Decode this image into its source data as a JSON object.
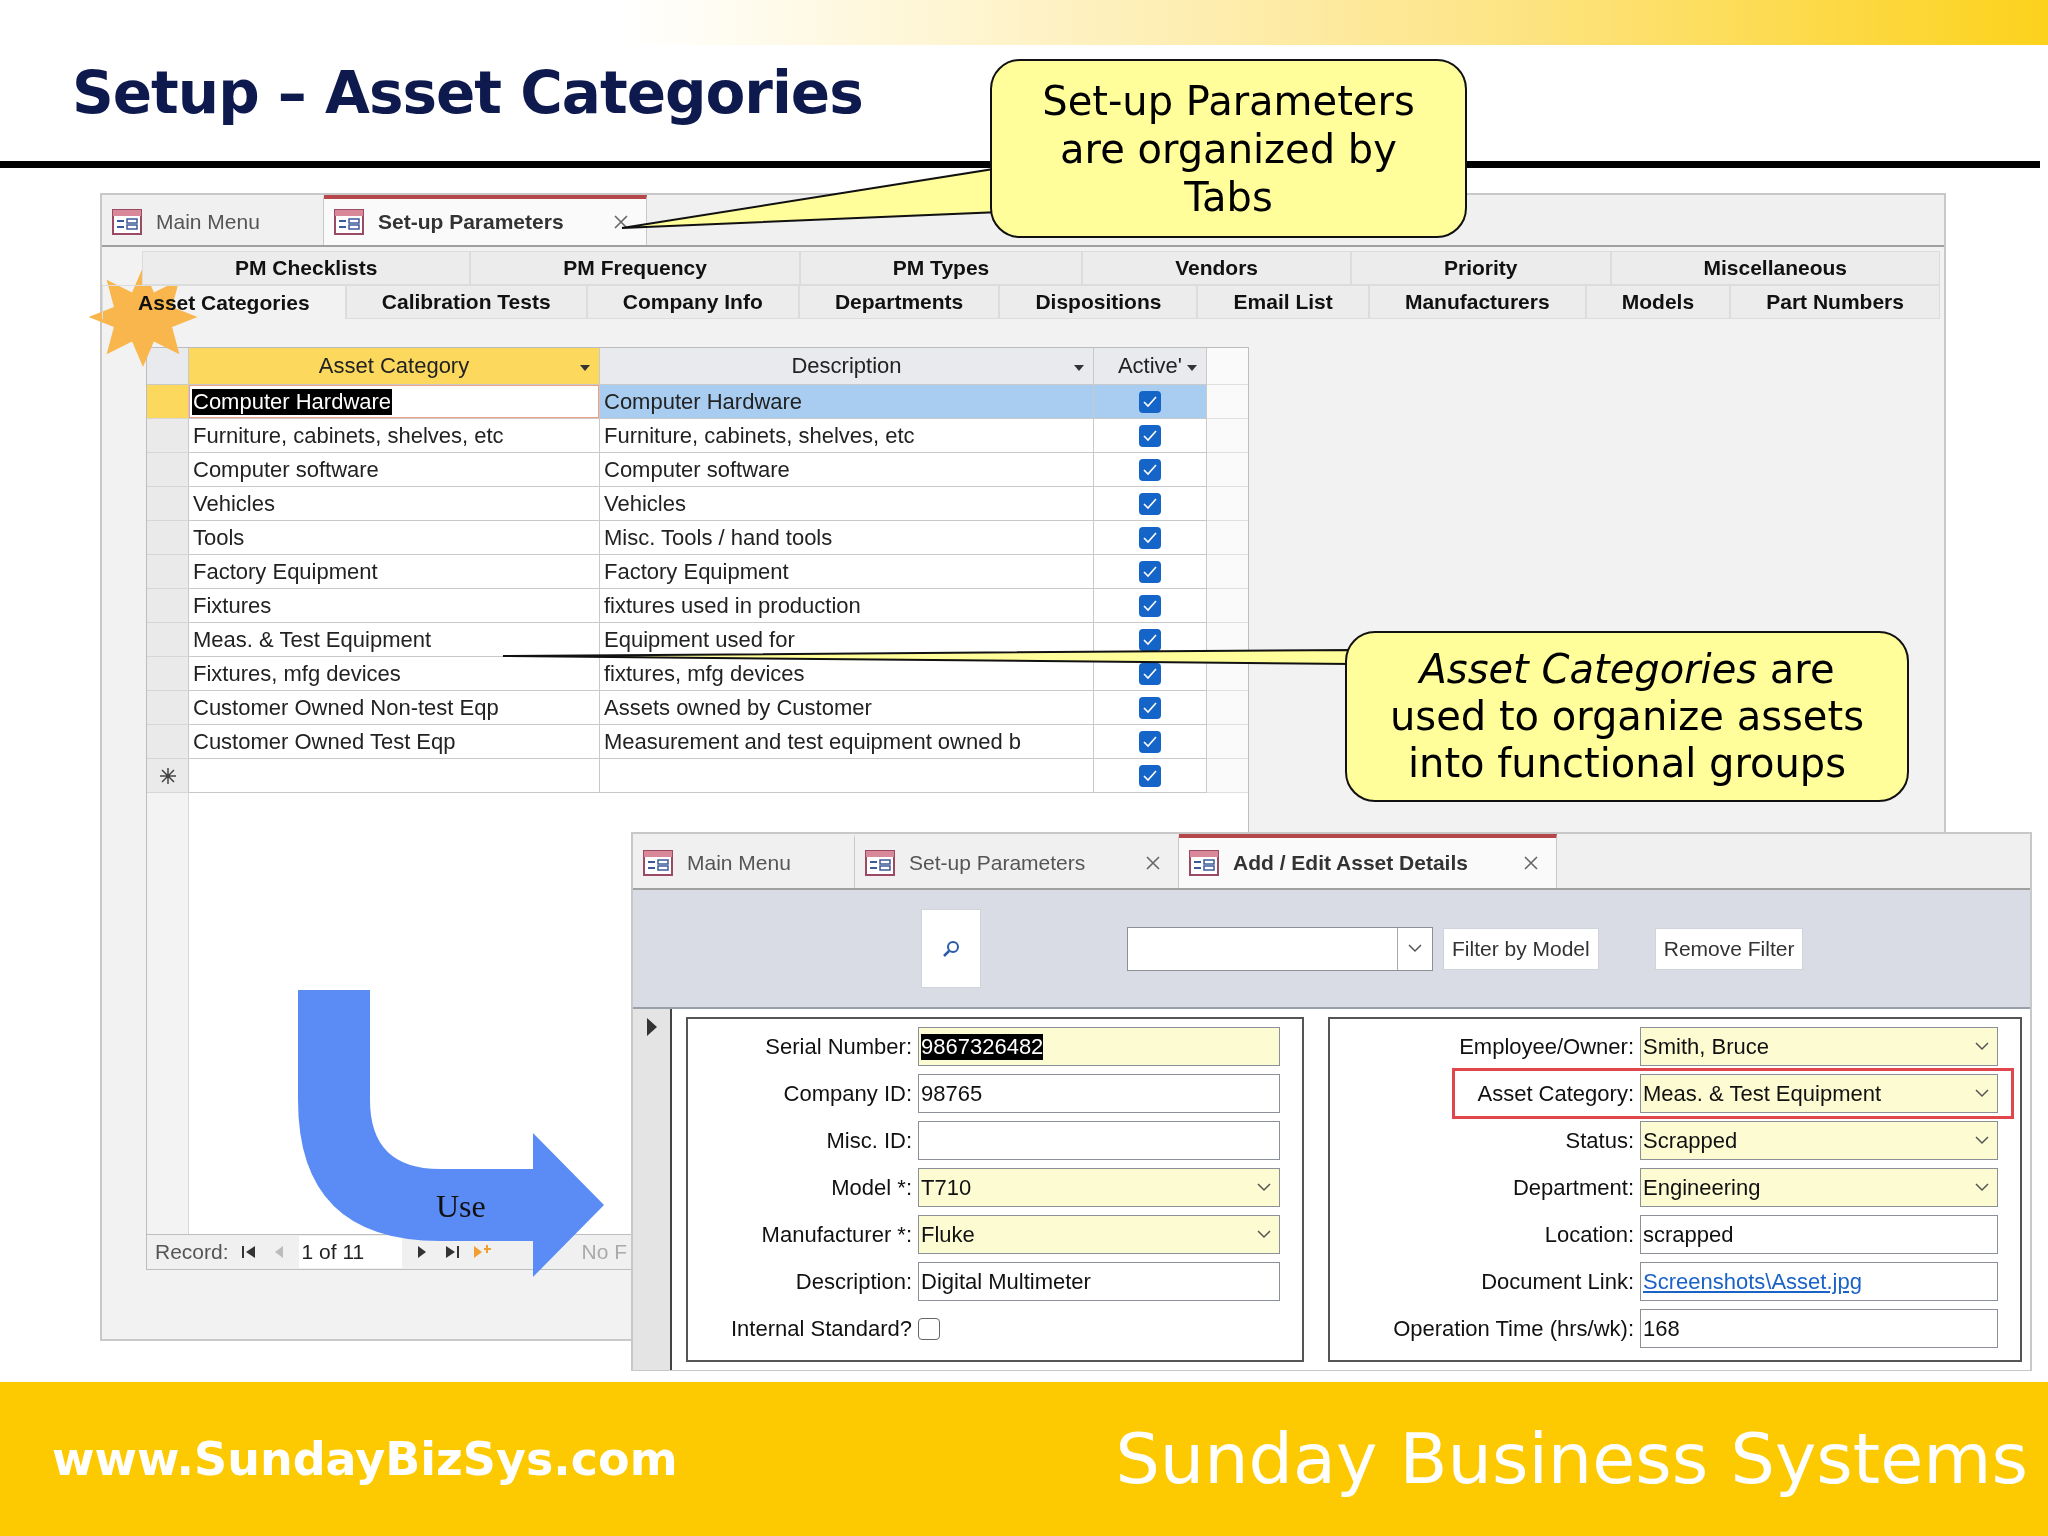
{
  "slide": {
    "title": "Setup – Asset Categories",
    "callouts": [
      {
        "text": "Set-up Parameters are organized by Tabs"
      },
      {
        "text": "*Asset Categories* are used to organize assets into functional groups"
      }
    ],
    "arrow_label": "Use",
    "footer": {
      "url": "www.SundayBizSys.com",
      "brand": "Sunday Business Systems"
    }
  },
  "setup_window": {
    "tabs": [
      {
        "label": "Main Menu",
        "selected": false,
        "closable": false
      },
      {
        "label": "Set-up Parameters",
        "selected": true,
        "closable": true
      }
    ],
    "subtabs": {
      "row_1": [
        {
          "label": "PM Checklists",
          "selected": false
        },
        {
          "label": "PM Frequency",
          "selected": false
        },
        {
          "label": "PM Types",
          "selected": false
        },
        {
          "label": "Vendors",
          "selected": false
        },
        {
          "label": "Priority",
          "selected": false
        },
        {
          "label": "Miscellaneous",
          "selected": false
        }
      ],
      "row_2": [
        {
          "label": "Asset Categories",
          "selected": true
        },
        {
          "label": "Calibration Tests",
          "selected": false
        },
        {
          "label": "Company Info",
          "selected": false
        },
        {
          "label": "Departments",
          "selected": false
        },
        {
          "label": "Dispositions",
          "selected": false
        },
        {
          "label": "Email List",
          "selected": false
        },
        {
          "label": "Manufacturers",
          "selected": false
        },
        {
          "label": "Models",
          "selected": false
        },
        {
          "label": "Part Numbers",
          "selected": false
        }
      ]
    },
    "datasheet": {
      "columns": [
        {
          "label": "Asset Category",
          "sorted": true
        },
        {
          "label": "Description",
          "sorted": false
        },
        {
          "label": "Active'",
          "sorted": false
        }
      ],
      "rows": [
        {
          "category": "Computer Hardware",
          "description": "Computer Hardware",
          "active": true,
          "selected": true
        },
        {
          "category": "Furniture, cabinets, shelves, etc",
          "description": "Furniture, cabinets, shelves, etc",
          "active": true,
          "selected": false
        },
        {
          "category": "Computer software",
          "description": "Computer software",
          "active": true,
          "selected": false
        },
        {
          "category": "Vehicles",
          "description": "Vehicles",
          "active": true,
          "selected": false
        },
        {
          "category": "Tools",
          "description": "Misc. Tools / hand tools",
          "active": true,
          "selected": false
        },
        {
          "category": "Factory Equipment",
          "description": "Factory Equipment",
          "active": true,
          "selected": false
        },
        {
          "category": "Fixtures",
          "description": "fixtures used in production",
          "active": true,
          "selected": false
        },
        {
          "category": "Meas. & Test Equipment",
          "description": "Equipment used for",
          "active": true,
          "selected": false
        },
        {
          "category": "Fixtures, mfg devices",
          "description": "fixtures, mfg devices",
          "active": true,
          "selected": false
        },
        {
          "category": "Customer Owned Non-test Eqp",
          "description": "Assets owned by Customer",
          "active": true,
          "selected": false
        },
        {
          "category": "Customer Owned Test Eqp",
          "description": "Measurement and test equipment owned b",
          "active": true,
          "selected": false
        }
      ],
      "new_row": {
        "active": true
      }
    },
    "record_nav": {
      "label": "Record:",
      "position": "1 of 11",
      "filter": "No F"
    }
  },
  "details_window": {
    "tabs": [
      {
        "label": "Main Menu",
        "selected": false,
        "closable": false
      },
      {
        "label": "Set-up Parameters",
        "selected": false,
        "closable": true
      },
      {
        "label": "Add / Edit Asset Details",
        "selected": true,
        "closable": true
      }
    ],
    "toolbar": {
      "filter_button": "Filter by Model",
      "remove_button": "Remove Filter"
    },
    "fields_left": [
      {
        "label": "Serial Number:",
        "value": "9867326482",
        "kind": "text",
        "required": true,
        "focused": true
      },
      {
        "label": "Company ID:",
        "value": "98765",
        "kind": "text",
        "required": false,
        "focused": false
      },
      {
        "label": "Misc. ID:",
        "kind": "text",
        "required": false
      },
      {
        "label": "Model *:",
        "value": "T710",
        "kind": "combo",
        "required": true,
        "focused": false
      },
      {
        "label": "Manufacturer *:",
        "value": "Fluke",
        "kind": "combo",
        "required": true,
        "focused": false
      },
      {
        "label": "Description:",
        "value": "Digital Multimeter",
        "kind": "text",
        "required": false,
        "focused": false
      },
      {
        "label": "Internal Standard?",
        "kind": "checkbox",
        "checked": false
      }
    ],
    "fields_right": [
      {
        "label": "Employee/Owner:",
        "value": "Smith, Bruce",
        "kind": "combo",
        "required": true,
        "highlighted": false
      },
      {
        "label": "Asset Category:",
        "value": "Meas. & Test Equipment",
        "kind": "combo",
        "required": true,
        "highlighted": true
      },
      {
        "label": "Status:",
        "value": "Scrapped",
        "kind": "combo",
        "required": true,
        "highlighted": false
      },
      {
        "label": "Department:",
        "value": "Engineering",
        "kind": "combo",
        "required": true,
        "highlighted": false
      },
      {
        "label": "Location:",
        "value": "scrapped",
        "kind": "text",
        "required": false,
        "highlighted": false
      },
      {
        "label": "Document Link:",
        "value": "Screenshots\\Asset.jpg",
        "kind": "link",
        "required": false,
        "highlighted": false
      },
      {
        "label": "Operation Time (hrs/wk):",
        "value": "168",
        "kind": "text",
        "required": false,
        "highlighted": false
      }
    ]
  }
}
